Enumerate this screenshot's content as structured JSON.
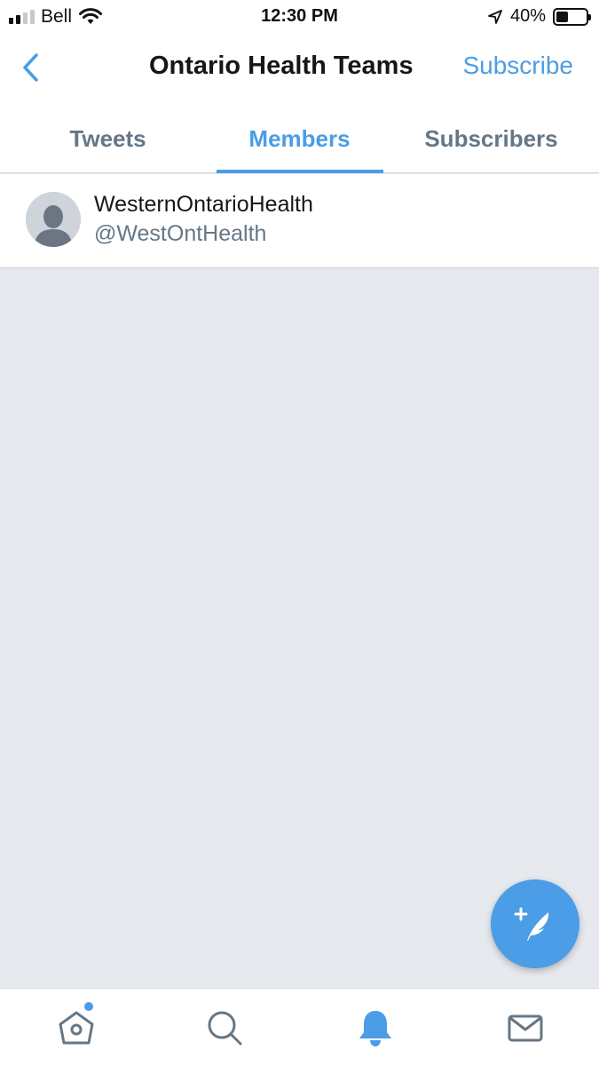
{
  "status_bar": {
    "carrier": "Bell",
    "time": "12:30 PM",
    "battery_percent": "40%",
    "battery_level": 0.4,
    "signal_bars": 4,
    "signal_bars_active": 2
  },
  "header": {
    "title": "Ontario Health Teams",
    "subscribe_label": "Subscribe",
    "back_icon": "chevron-left-icon"
  },
  "tabs": [
    {
      "label": "Tweets",
      "active": false
    },
    {
      "label": "Members",
      "active": true
    },
    {
      "label": "Subscribers",
      "active": false
    }
  ],
  "members": [
    {
      "name": "WesternOntarioHealth",
      "handle": "@WestOntHealth",
      "avatar": "default-avatar-icon"
    }
  ],
  "fab": {
    "icon": "compose-tweet-icon"
  },
  "bottom_nav": [
    {
      "icon": "home-icon",
      "has_dot": true
    },
    {
      "icon": "search-icon"
    },
    {
      "icon": "bell-icon",
      "active": true
    },
    {
      "icon": "mail-icon"
    }
  ],
  "colors": {
    "accent": "#4a9de6",
    "secondary_text": "#657786",
    "background": "#e6e9ee"
  }
}
